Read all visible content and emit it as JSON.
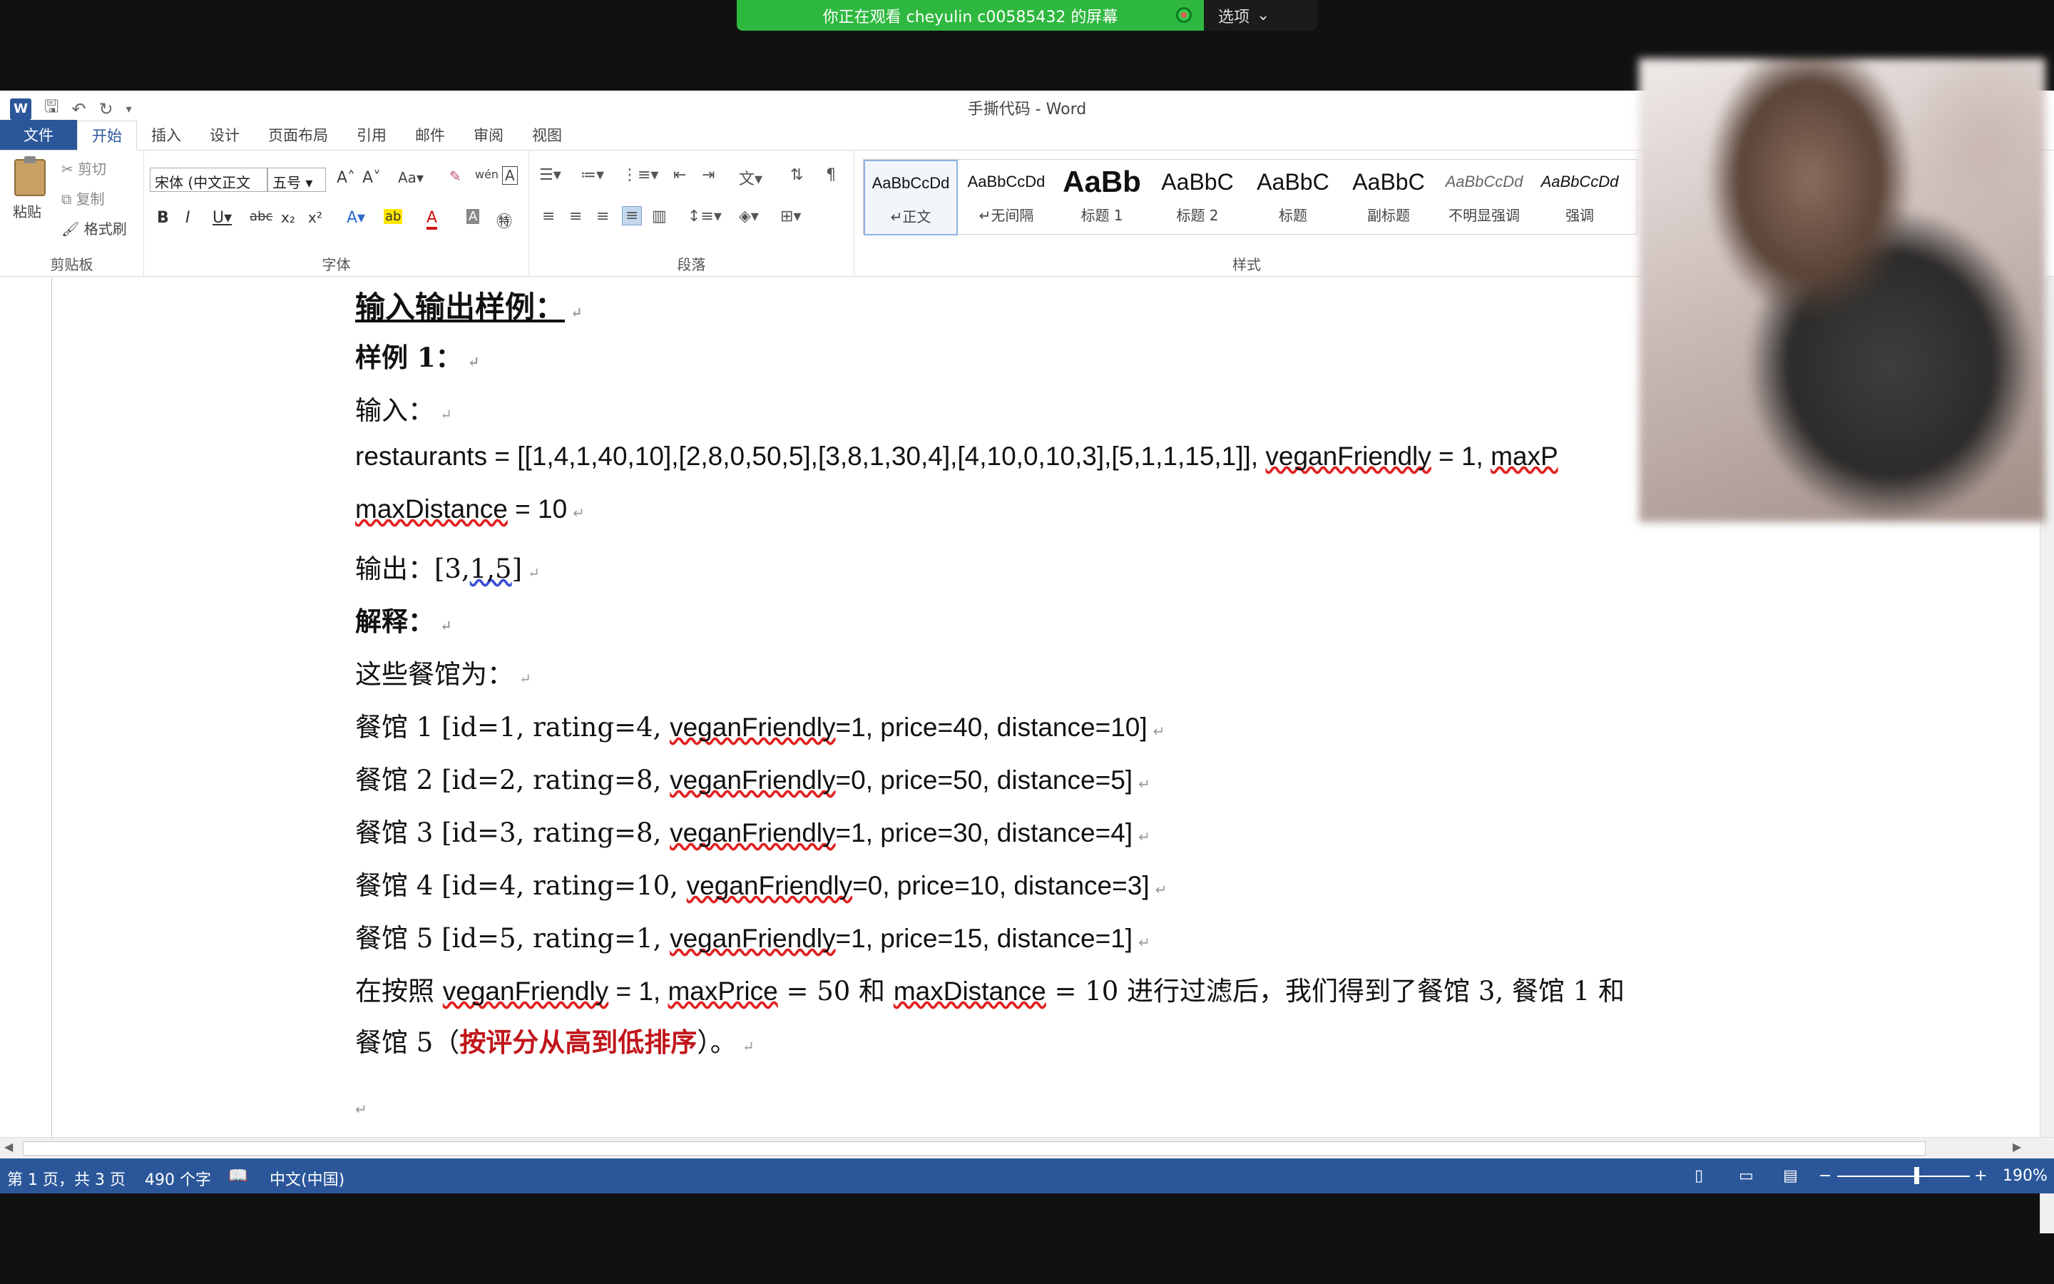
{
  "share_banner": {
    "message": "你正在观看 cheyulin c00585432 的屏幕",
    "options": "选项"
  },
  "window": {
    "title": "手撕代码 - Word"
  },
  "tabs": [
    "文件",
    "开始",
    "插入",
    "设计",
    "页面布局",
    "引用",
    "邮件",
    "审阅",
    "视图"
  ],
  "ribbon": {
    "clipboard": {
      "paste": "粘贴",
      "cut": "剪切",
      "copy": "复制",
      "format_painter": "格式刷",
      "label": "剪贴板"
    },
    "font": {
      "font_name": "宋体 (中文正文",
      "font_size": "五号",
      "label": "字体"
    },
    "paragraph": {
      "label": "段落"
    },
    "styles": {
      "label": "样式",
      "items": [
        {
          "sample": "AaBbCcDd",
          "name": "↵正文"
        },
        {
          "sample": "AaBbCcDd",
          "name": "↵无间隔"
        },
        {
          "sample": "AaBb",
          "name": "标题 1"
        },
        {
          "sample": "AaBbC",
          "name": "标题 2"
        },
        {
          "sample": "AaBbC",
          "name": "标题"
        },
        {
          "sample": "AaBbC",
          "name": "副标题"
        },
        {
          "sample": "AaBbCcDd",
          "name": "不明显强调"
        },
        {
          "sample": "AaBbCcDd",
          "name": "强调"
        }
      ]
    }
  },
  "document": {
    "heading": "输入输出样例：",
    "example_label": "样例 1：",
    "input_label": "输入：",
    "input_line1": {
      "pre": "restaurants = [[1,4,1,40,10],[2,8,0,50,5],[3,8,1,30,4],[4,10,0,10,3],[5,1,1,15,1]], ",
      "w1": "veganFriendly",
      "mid": " = 1, ",
      "w2": "maxP"
    },
    "input_line2": {
      "w": "maxDistance",
      "post": " = 10"
    },
    "output": {
      "label": "输出：[3,",
      "val": "1,5",
      "end": "]"
    },
    "explain_label": "解释：",
    "restaurants_intro": "这些餐馆为：",
    "restaurants": [
      {
        "pre": "餐馆  1 [id=1, rating=4, ",
        "vf": "veganFriendly",
        "post": "=1, price=40, distance=10]"
      },
      {
        "pre": "餐馆  2 [id=2, rating=8, ",
        "vf": "veganFriendly",
        "post": "=0, price=50, distance=5]"
      },
      {
        "pre": "餐馆  3 [id=3, rating=8, ",
        "vf": "veganFriendly",
        "post": "=1, price=30, distance=4]"
      },
      {
        "pre": "餐馆  4 [id=4, rating=10, ",
        "vf": "veganFriendly",
        "post": "=0, price=10, distance=3]"
      },
      {
        "pre": "餐馆  5 [id=5, rating=1, ",
        "vf": "veganFriendly",
        "post": "=1, price=15, distance=1]"
      }
    ],
    "conclusion": {
      "t1": "在按照 ",
      "w1": "veganFriendly",
      "t2": " = 1, ",
      "w2": "maxPrice",
      "t3": " = 50  和  ",
      "w3": "maxDistance",
      "t4": " = 10  进行过滤后，我们得到了餐馆  3,  餐馆  1  和",
      "t5": "餐馆  5（",
      "red": "按评分从高到低排序",
      "t6": "）。"
    }
  },
  "status": {
    "page": "第 1 页，共 3 页",
    "words": "490 个字",
    "language": "中文(中国)",
    "zoom": "190%"
  }
}
